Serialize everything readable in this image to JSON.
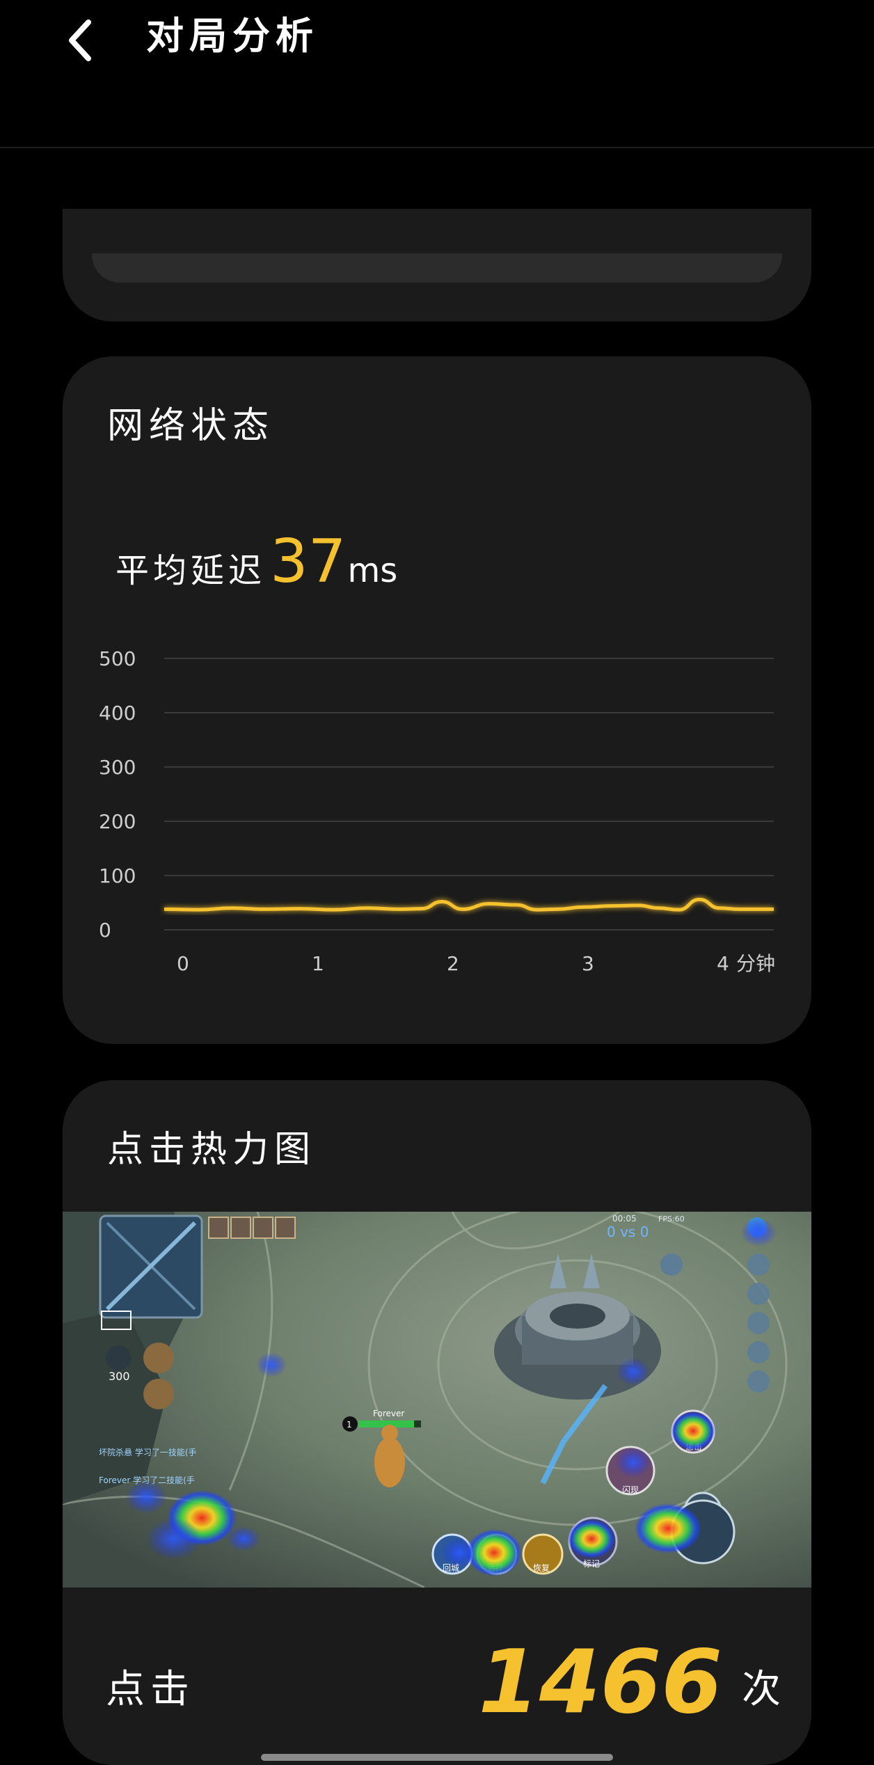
{
  "header": {
    "title": "对局分析",
    "back_icon": "chevron-left-icon"
  },
  "network_card": {
    "title": "网络状态",
    "avg_label": "平均延迟",
    "avg_value": "37",
    "avg_unit": "ms"
  },
  "chart_data": {
    "type": "line",
    "title": "",
    "xlabel": "分钟",
    "ylabel": "",
    "xlim": [
      0,
      4.5
    ],
    "ylim": [
      0,
      500
    ],
    "x_ticks": [
      "0",
      "1",
      "2",
      "3",
      "4"
    ],
    "y_ticks": [
      "0",
      "100",
      "200",
      "300",
      "400",
      "500"
    ],
    "grid": true,
    "line_color": "#f5c12e",
    "series": [
      {
        "x": [
          0,
          0.25,
          0.5,
          0.75,
          1.0,
          1.25,
          1.5,
          1.75,
          1.9,
          2.05,
          2.2,
          2.4,
          2.6,
          2.75,
          2.9,
          3.1,
          3.3,
          3.5,
          3.65,
          3.8,
          3.95,
          4.1,
          4.25,
          4.5
        ],
        "values": [
          38,
          37,
          40,
          38,
          39,
          37,
          40,
          38,
          39,
          52,
          38,
          48,
          46,
          37,
          38,
          42,
          44,
          45,
          40,
          37,
          56,
          40,
          38,
          38
        ]
      }
    ]
  },
  "heatmap_card": {
    "title": "点击热力图",
    "clicks_label": "点击",
    "clicks_value": "1466",
    "clicks_unit": "次",
    "game": {
      "time": "00:05",
      "score": "0 vs 0",
      "fps": "FPS:60",
      "gold": "300",
      "player_name": "Forever",
      "level": "1",
      "chat_line_1": "坏院杀悬 学习了一技能(手",
      "chat_line_2": "Forever 学习了二技能(手",
      "skill_labels": [
        "回城",
        "治疗",
        "恢复",
        "标记",
        "惩击",
        "闪现"
      ]
    }
  }
}
